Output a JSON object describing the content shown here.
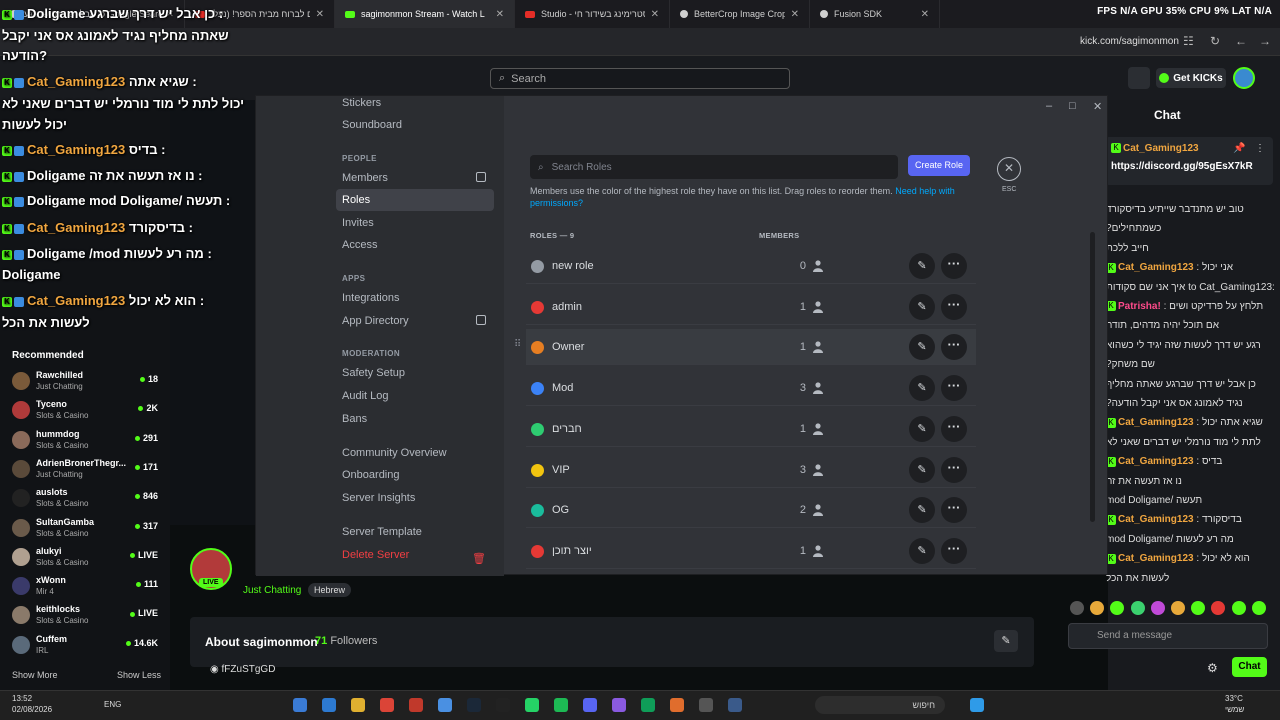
{
  "browser": {
    "tabs": [
      {
        "label": "כן אבל יש דרך שברגע Google Search"
      },
      {
        "label": "מנסים לברוח מבית הספר! (נעלי"
      },
      {
        "label": "sagimonmon Stream - Watch L"
      },
      {
        "label": "Studio - סטרימינג בשידור חי"
      },
      {
        "label": "BetterCrop Image Cropping"
      },
      {
        "label": "Fusion SDK"
      }
    ],
    "stats": "FPS N/A  GPU 35%  CPU 9%  LAT N/A",
    "url": "kick.com/sagimonmon"
  },
  "kick": {
    "search_placeholder": "Search",
    "get_kicks": "Get KICKs",
    "recommended_title": "Recommended",
    "recommended": [
      {
        "name": "Rawchilled",
        "category": "Just Chatting",
        "viewers": "18",
        "color": "#7a5a3a"
      },
      {
        "name": "Tyceno",
        "category": "Slots & Casino",
        "viewers": "2K",
        "color": "#b03a3a"
      },
      {
        "name": "hummdog",
        "category": "Slots & Casino",
        "viewers": "291",
        "color": "#8a6a5a"
      },
      {
        "name": "AdrienBronerThegr...",
        "category": "Just Chatting",
        "viewers": "171",
        "color": "#5a4a3a"
      },
      {
        "name": "auslots",
        "category": "Slots & Casino",
        "viewers": "846",
        "color": "#222222"
      },
      {
        "name": "SultanGamba",
        "category": "Slots & Casino",
        "viewers": "317",
        "color": "#6a5a4a"
      },
      {
        "name": "alukyi",
        "category": "Slots & Casino",
        "viewers": "LIVE",
        "color": "#b0a090"
      },
      {
        "name": "xWonn",
        "category": "Mir 4",
        "viewers": "111",
        "color": "#3a3a6a"
      },
      {
        "name": "keithlocks",
        "category": "Slots & Casino",
        "viewers": "LIVE",
        "color": "#8a7a6a"
      },
      {
        "name": "Cuffem",
        "category": "IRL",
        "viewers": "14.6K",
        "color": "#5a6a7a"
      }
    ],
    "show_more": "Show More",
    "show_less": "Show Less",
    "live_badge": "LIVE",
    "category": "Just Chatting",
    "tag": "Hebrew",
    "about_title": "About sagimonmon",
    "followers_count": "71",
    "followers_label": "Followers",
    "discord": "fFZuSTgGD"
  },
  "overlay_chat": [
    {
      "user": "Doligame",
      "text": "כן אבל יש דרך שברגע :",
      "cls": "u2"
    },
    {
      "user": "",
      "text": "שאתה מחליף נגיד לאמונג אס אני יקבל",
      "cls": ""
    },
    {
      "user": "",
      "text": "הודעה?",
      "cls": ""
    },
    {
      "user": "Cat_Gaming123",
      "text": "שגיא אתה :",
      "cls": "u"
    },
    {
      "user": "",
      "text": "יכול לתת לי מוד נורמלי יש דברים שאני לא",
      "cls": ""
    },
    {
      "user": "",
      "text": "יכול לעשות",
      "cls": ""
    },
    {
      "user": "Cat_Gaming123",
      "text": "בדיס :",
      "cls": "u"
    },
    {
      "user": "Doligame",
      "text": "נו אז תעשה את זה :",
      "cls": "u2"
    },
    {
      "user": "Doligame",
      "text": "mod Doligame/ תעשה :",
      "cls": "u2"
    },
    {
      "user": "Cat_Gaming123",
      "text": "בדיסקורד :",
      "cls": "u"
    },
    {
      "user": "Doligame",
      "text": "/mod מה רע לעשות :",
      "cls": "u2"
    },
    {
      "user": "",
      "text": "Doligame",
      "cls": ""
    },
    {
      "user": "Cat_Gaming123",
      "text": "הוא לא יכול :",
      "cls": "u"
    },
    {
      "user": "",
      "text": "לעשות את הכל",
      "cls": ""
    }
  ],
  "settings": {
    "menu": [
      {
        "type": "item",
        "label": "Stickers"
      },
      {
        "type": "item",
        "label": "Soundboard"
      },
      {
        "type": "header",
        "label": "PEOPLE"
      },
      {
        "type": "item",
        "label": "Members",
        "ext": true
      },
      {
        "type": "item",
        "label": "Roles",
        "selected": true
      },
      {
        "type": "item",
        "label": "Invites"
      },
      {
        "type": "item",
        "label": "Access"
      },
      {
        "type": "header",
        "label": "APPS"
      },
      {
        "type": "item",
        "label": "Integrations"
      },
      {
        "type": "item",
        "label": "App Directory",
        "ext": true
      },
      {
        "type": "header",
        "label": "MODERATION"
      },
      {
        "type": "item",
        "label": "Safety Setup"
      },
      {
        "type": "item",
        "label": "Audit Log"
      },
      {
        "type": "item",
        "label": "Bans"
      },
      {
        "type": "item",
        "label": "Community Overview"
      },
      {
        "type": "item",
        "label": "Onboarding"
      },
      {
        "type": "item",
        "label": "Server Insights"
      },
      {
        "type": "item",
        "label": "Server Template"
      },
      {
        "type": "item",
        "label": "Delete Server",
        "danger": true
      }
    ],
    "search_placeholder": "Search Roles",
    "create_role": "Create Role",
    "esc_label": "ESC",
    "description": "Members use the color of the highest role they have on this list. Drag roles to reorder them.",
    "help_link": "Need help with permissions?",
    "roles_header": "ROLES — 9",
    "members_header": "MEMBERS",
    "roles": [
      {
        "name": "new role",
        "members": "0",
        "color": "#949ba4"
      },
      {
        "name": "admin",
        "members": "1",
        "color": "#e53935"
      },
      {
        "name": "Owner",
        "members": "1",
        "color": "#e67e22"
      },
      {
        "name": "Mod",
        "members": "3",
        "color": "#3b82f6"
      },
      {
        "name": "חברים",
        "members": "1",
        "color": "#2ecc71"
      },
      {
        "name": "VIP",
        "members": "3",
        "color": "#f1c40f"
      },
      {
        "name": "OG",
        "members": "2",
        "color": "#1abc9c"
      },
      {
        "name": "יוצר תוכן",
        "members": "1",
        "color": "#e53935"
      }
    ]
  },
  "right_chat": {
    "title": "Chat",
    "pinned_user": "Cat_Gaming123",
    "pinned_link": "https://discord.gg/95gEsX7kR",
    "messages": [
      {
        "user": "",
        "text": "טוב יש מתנדבר שייתיע בדיסקורד"
      },
      {
        "user": "",
        "text": "?כשמתחילים"
      },
      {
        "user": "",
        "text": "חייב ללכת"
      },
      {
        "user": "Cat_Gaming123",
        "text": ": אני יכול"
      },
      {
        "user": "",
        "text": "איך אני שם סקודות to Cat_Gaming123:"
      },
      {
        "user": "Patrisha!",
        "text": ": תלחץ על פרדיקט ושים"
      },
      {
        "user": "",
        "text": "אם תוכל יהיה מדהים, תודה"
      },
      {
        "user": "",
        "text": "רגע יש דרך לעשות שזה יגיד לי כשהוא"
      },
      {
        "user": "",
        "text": "?שם משחק"
      },
      {
        "user": "",
        "text": "כן אבל יש דרך שברגע שאתה מחליף"
      },
      {
        "user": "",
        "text": "?נגיד לאמונג אס אני יקבל הודעה"
      },
      {
        "user": "Cat_Gaming123",
        "text": ": שגיא אתה יכול"
      },
      {
        "user": "",
        "text": "לתת לי מוד נורמלי יש דברים שאני לא"
      },
      {
        "user": "Cat_Gaming123",
        "text": ": בדיס"
      },
      {
        "user": "",
        "text": "נו אז תעשה את זה"
      },
      {
        "user": "",
        "text": "mod Doligame/ תעשה"
      },
      {
        "user": "Cat_Gaming123",
        "text": ": בדיסקורד"
      },
      {
        "user": "",
        "text": "mod Doligame/ מה רע לעשות"
      },
      {
        "user": "Cat_Gaming123",
        "text": ": הוא לא יכול"
      },
      {
        "user": "",
        "text": "לעשות את הכל"
      }
    ],
    "send_placeholder": "Send a message",
    "chat_button": "Chat"
  },
  "taskbar": {
    "time": "13:52",
    "date": "02/08/2026",
    "lang": "ENG",
    "search": "חיפוש",
    "temp": "33°C",
    "weather": "שמשי"
  }
}
